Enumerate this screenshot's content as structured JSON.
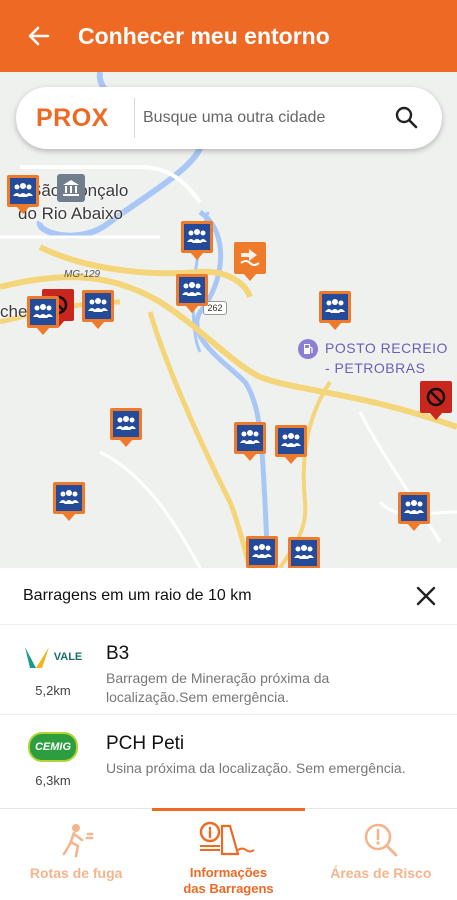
{
  "appbar": {
    "title": "Conhecer meu entorno"
  },
  "search": {
    "logo_text": "PROX",
    "placeholder": "Busque uma outra cidade"
  },
  "map": {
    "place_labels": [
      "São Gonçalo",
      "do Rio Abaixo"
    ],
    "poi": {
      "line1": "POSTO RECREIO",
      "line2": "- PETROBRAS"
    },
    "road_labels": [
      "MG-129",
      "262"
    ],
    "partial_labels": [
      "che"
    ]
  },
  "sheet": {
    "title": "Barragens em um raio de 10 km",
    "dams": [
      {
        "company": "VALE",
        "name": "B3",
        "distance": "5,2km",
        "description": "Barragem de Mineração próxima da localização.Sem emergência."
      },
      {
        "company": "CEMIG",
        "name": "PCH Peti",
        "distance": "6,3km",
        "description": "Usina próxima da localização. Sem emergência."
      }
    ]
  },
  "nav": {
    "items": [
      {
        "label": "Rotas de fuga",
        "icon": "running-person-icon"
      },
      {
        "label_line1": "Informações",
        "label_line2": "das Barragens",
        "icon": "dam-info-icon"
      },
      {
        "label": "Áreas de Risco",
        "icon": "search-alert-icon"
      }
    ]
  },
  "colors": {
    "primary": "#ee6a24",
    "pin_blue": "#234b9a",
    "danger": "#c9261d"
  }
}
